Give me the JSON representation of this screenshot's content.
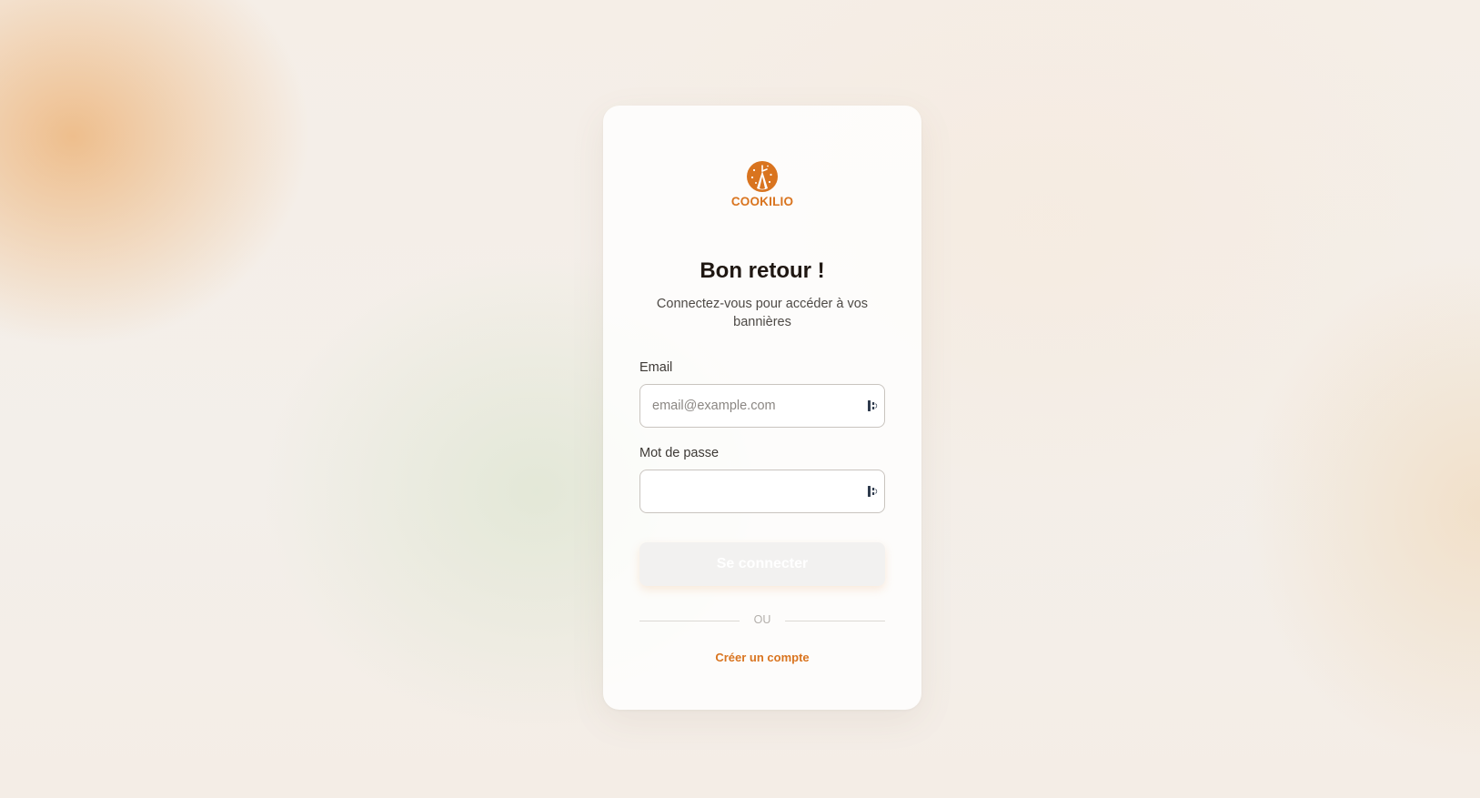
{
  "brand": {
    "name": "COOKILIO",
    "color": "#d9741f",
    "logo_icon": "cookie-shield-logo"
  },
  "login": {
    "title": "Bon retour !",
    "subtitle": "Connectez-vous pour accéder à vos bannières",
    "email_label": "Email",
    "email_placeholder": "email@example.com",
    "email_value": "",
    "password_label": "Mot de passe",
    "password_value": "",
    "password_manager_icon": "password-manager-icon",
    "submit_label": "Se connecter",
    "divider_text": "OU",
    "create_account_label": "Créer un compte"
  }
}
